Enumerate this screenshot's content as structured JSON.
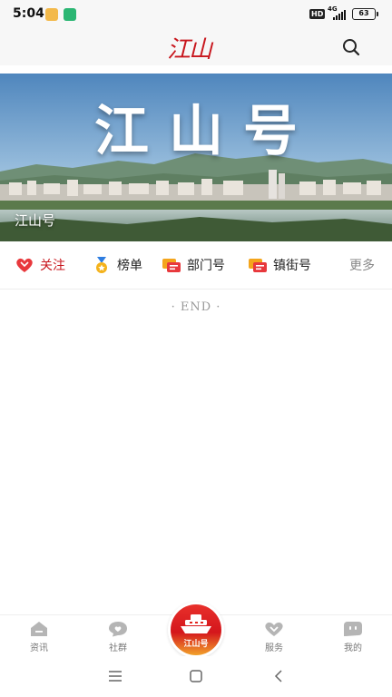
{
  "status_bar": {
    "time": "5:04",
    "hd_badge": "HD",
    "network": "4G",
    "battery": "63"
  },
  "header": {
    "logo_text": "江山",
    "search_icon": "search-icon"
  },
  "banner": {
    "title": "江山号",
    "caption": "江山号"
  },
  "categories": [
    {
      "label": "关注",
      "icon": "heart-icon",
      "active": true
    },
    {
      "label": "榜单",
      "icon": "medal-icon",
      "active": false
    },
    {
      "label": "部门号",
      "icon": "chat-bubble-icon",
      "active": false
    },
    {
      "label": "镇街号",
      "icon": "chat-bubble-icon",
      "active": false
    },
    {
      "label": "更多",
      "icon": "",
      "active": false
    }
  ],
  "end_text": "· END ·",
  "tabbar": {
    "tabs": [
      {
        "label": "资讯",
        "icon": "home-icon"
      },
      {
        "label": "社群",
        "icon": "heart-bubble-icon"
      },
      {
        "label": "服务",
        "icon": "chevron-heart-icon"
      },
      {
        "label": "我的",
        "icon": "profile-icon"
      }
    ],
    "center_label": "江山号"
  },
  "colors": {
    "brand_red": "#c8161d",
    "accent_orange": "#f2a22b",
    "muted_text": "#999999"
  }
}
